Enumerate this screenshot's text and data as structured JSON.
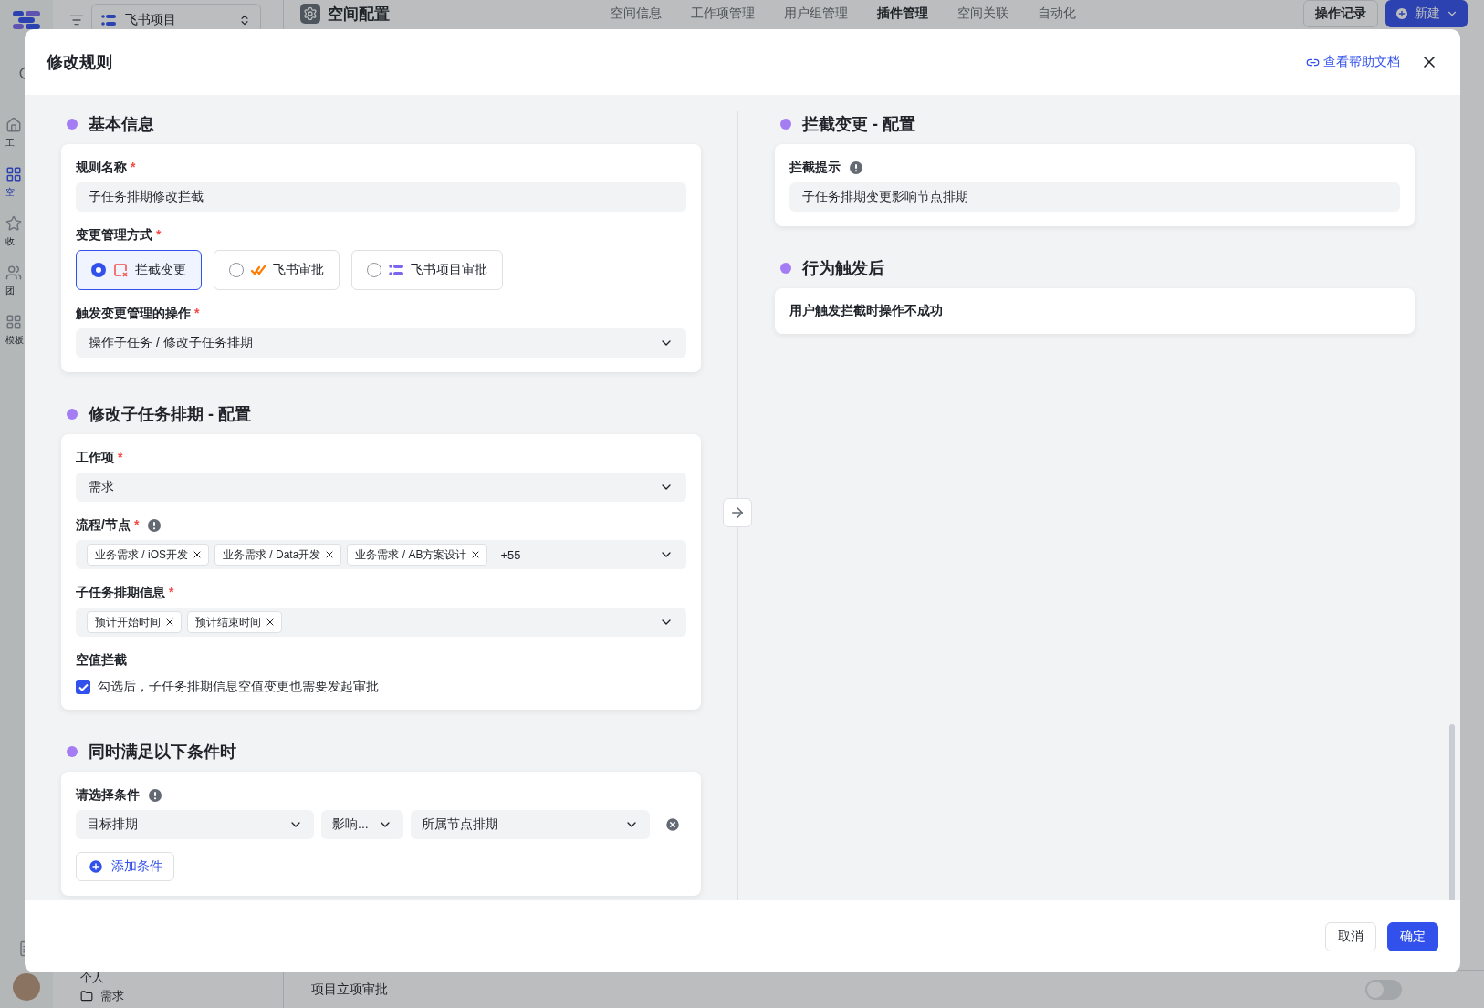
{
  "app": {
    "project_selector": "飞书项目",
    "page_title": "空间配置",
    "tabs": [
      {
        "label": "空间信息",
        "selected": false
      },
      {
        "label": "工作项管理",
        "selected": false
      },
      {
        "label": "用户组管理",
        "selected": false
      },
      {
        "label": "插件管理",
        "selected": true
      },
      {
        "label": "空间关联",
        "selected": false
      },
      {
        "label": "自动化",
        "selected": false
      }
    ],
    "history_button": "操作记录",
    "new_button": "新建",
    "sidebar": [
      {
        "label": "工",
        "selected": false
      },
      {
        "label": "空",
        "selected": true
      },
      {
        "label": "收",
        "selected": false
      },
      {
        "label": "团",
        "selected": false
      },
      {
        "label": "模板",
        "selected": false
      }
    ],
    "tree": [
      "个人",
      "需求"
    ],
    "list_row": {
      "label": "项目立项审批",
      "on": false
    }
  },
  "modal": {
    "title": "修改规则",
    "help_link": "查看帮助文档",
    "left_sections": [
      {
        "title": "基本信息",
        "fields": [
          {
            "kind": "text",
            "label": "规则名称",
            "required_mark": "*",
            "value": "子任务排期修改拦截"
          },
          {
            "kind": "radio",
            "label": "变更管理方式",
            "required_mark": "*",
            "options": [
              {
                "label": "拦截变更",
                "selected": true
              },
              {
                "label": "飞书审批",
                "selected": false
              },
              {
                "label": "飞书项目审批",
                "selected": false
              }
            ]
          },
          {
            "kind": "select",
            "label": "触发变更管理的操作",
            "required_mark": "*",
            "value": "操作子任务 / 修改子任务排期"
          }
        ]
      },
      {
        "title": "修改子任务排期 - 配置",
        "fields": [
          {
            "kind": "select",
            "label": "工作项",
            "required_mark": "*",
            "value": "需求"
          },
          {
            "kind": "tags",
            "label": "流程/节点",
            "required_mark": "*",
            "info": true,
            "tags": [
              "业务需求 / iOS开发",
              "业务需求 / Data开发",
              "业务需求 / AB方案设计"
            ],
            "more": "+55"
          },
          {
            "kind": "tags",
            "label": "子任务排期信息",
            "required_mark": "*",
            "tags": [
              "预计开始时间",
              "预计结束时间"
            ]
          },
          {
            "kind": "checkbox",
            "label": "空值拦截",
            "text": "勾选后，子任务排期信息空值变更也需要发起审批",
            "checked": true
          }
        ]
      },
      {
        "title": "同时满足以下条件时",
        "fields": [
          {
            "kind": "conditions",
            "label": "请选择条件",
            "info": true,
            "selects": [
              "目标排期",
              "影响...",
              "所属节点排期"
            ],
            "add": "添加条件"
          }
        ]
      }
    ],
    "right_sections": [
      {
        "title": "拦截变更 - 配置",
        "fields": [
          {
            "kind": "text",
            "label": "拦截提示",
            "info": true,
            "value": "子任务排期变更影响节点排期"
          }
        ]
      },
      {
        "title": "行为触发后",
        "fields": [
          {
            "kind": "plain",
            "text": "用户触发拦截时操作不成功"
          }
        ]
      }
    ],
    "cancel": "取消",
    "confirm": "确定"
  }
}
